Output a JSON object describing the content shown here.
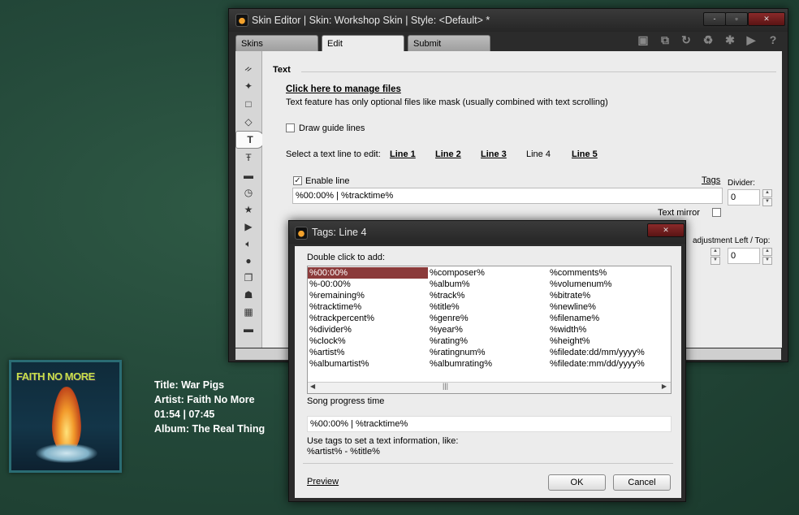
{
  "desktop": {
    "album_art_text": "FAITH NO MORE",
    "track": {
      "title": "Title: War Pigs",
      "artist": "Artist: Faith No More",
      "time": "01:54 | 07:45",
      "album": "Album: The Real Thing"
    }
  },
  "editor": {
    "title": "Skin Editor | Skin: Workshop Skin | Style: <Default> *",
    "window_buttons": {
      "minimize": "-",
      "maximize": "▫",
      "close": "✕"
    },
    "tabs": [
      {
        "label": "Skins"
      },
      {
        "label": "Edit"
      },
      {
        "label": "Submit"
      }
    ],
    "toolbar_icons": [
      "save-icon",
      "copy-icon",
      "undo-icon",
      "recycle-icon",
      "settings-icon",
      "play-icon",
      "help-icon"
    ],
    "section_title": "Text",
    "manage_files_link": "Click here to manage files",
    "description": "Text feature has only optional files like mask (usually combined with text scrolling)",
    "draw_guide_label": "Draw guide lines",
    "select_line_label": "Select a text line to edit:",
    "lines": [
      "Line 1",
      "Line 2",
      "Line 3",
      "Line 4",
      "Line 5"
    ],
    "enable_line_label": "Enable line",
    "enable_line_checked": "✓",
    "tags_link": "Tags",
    "divider_label": "Divider:",
    "divider_value": "0",
    "line_text": "%00:00% | %tracktime%",
    "text_mirror_label": "Text mirror",
    "adjust_label": "adjustment Left / Top:",
    "adjust_top_value": "0"
  },
  "dialog": {
    "title": "Tags: Line 4",
    "close": "✕",
    "instruction": "Double click to add:",
    "tags_col1": [
      "%00:00%",
      "%-00:00%",
      "%remaining%",
      "%tracktime%",
      "%trackpercent%",
      "%divider%",
      "%clock%",
      "%artist%",
      "%albumartist%"
    ],
    "tags_col2": [
      "%composer%",
      "%album%",
      "%track%",
      "%title%",
      "%genre%",
      "%year%",
      "%rating%",
      "%ratingnum%",
      "%albumrating%"
    ],
    "tags_col3": [
      "%comments%",
      "%volumenum%",
      "%bitrate%",
      "%newline%",
      "%filename%",
      "%width%",
      "%height%",
      "%filedate:dd/mm/yyyy%",
      "%filedate:mm/dd/yyyy%"
    ],
    "selected_description": "Song progress time",
    "value": "%00:00% | %tracktime%",
    "hint_line1": "Use tags to set a text information, like:",
    "hint_line2": "%artist% - %title%",
    "preview_link": "Preview",
    "ok_label": "OK",
    "cancel_label": "Cancel"
  }
}
